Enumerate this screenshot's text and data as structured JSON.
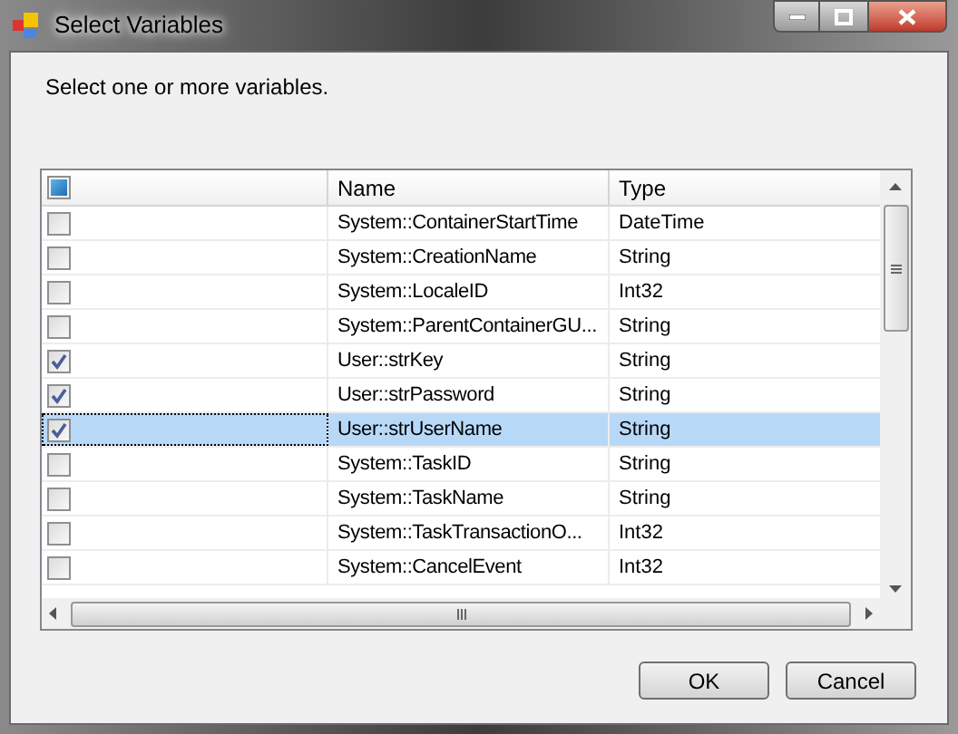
{
  "window": {
    "title": "Select Variables"
  },
  "instruction": "Select one or more variables.",
  "table": {
    "header_checkbox": {
      "partial": true
    },
    "columns": [
      "Name",
      "Type"
    ],
    "rows": [
      {
        "name": "System::ContainerStartTime",
        "type": "DateTime",
        "checked": false,
        "selected": false
      },
      {
        "name": "System::CreationName",
        "type": "String",
        "checked": false,
        "selected": false
      },
      {
        "name": "System::LocaleID",
        "type": "Int32",
        "checked": false,
        "selected": false
      },
      {
        "name": "System::ParentContainerGU...",
        "type": "String",
        "checked": false,
        "selected": false
      },
      {
        "name": "User::strKey",
        "type": "String",
        "checked": true,
        "selected": false
      },
      {
        "name": "User::strPassword",
        "type": "String",
        "checked": true,
        "selected": false
      },
      {
        "name": "User::strUserName",
        "type": "String",
        "checked": true,
        "selected": true
      },
      {
        "name": "System::TaskID",
        "type": "String",
        "checked": false,
        "selected": false
      },
      {
        "name": "System::TaskName",
        "type": "String",
        "checked": false,
        "selected": false
      },
      {
        "name": "System::TaskTransactionO...",
        "type": "Int32",
        "checked": false,
        "selected": false
      },
      {
        "name": "System::CancelEvent",
        "type": "Int32",
        "checked": false,
        "selected": false
      }
    ]
  },
  "buttons": [
    "OK",
    "Cancel"
  ]
}
